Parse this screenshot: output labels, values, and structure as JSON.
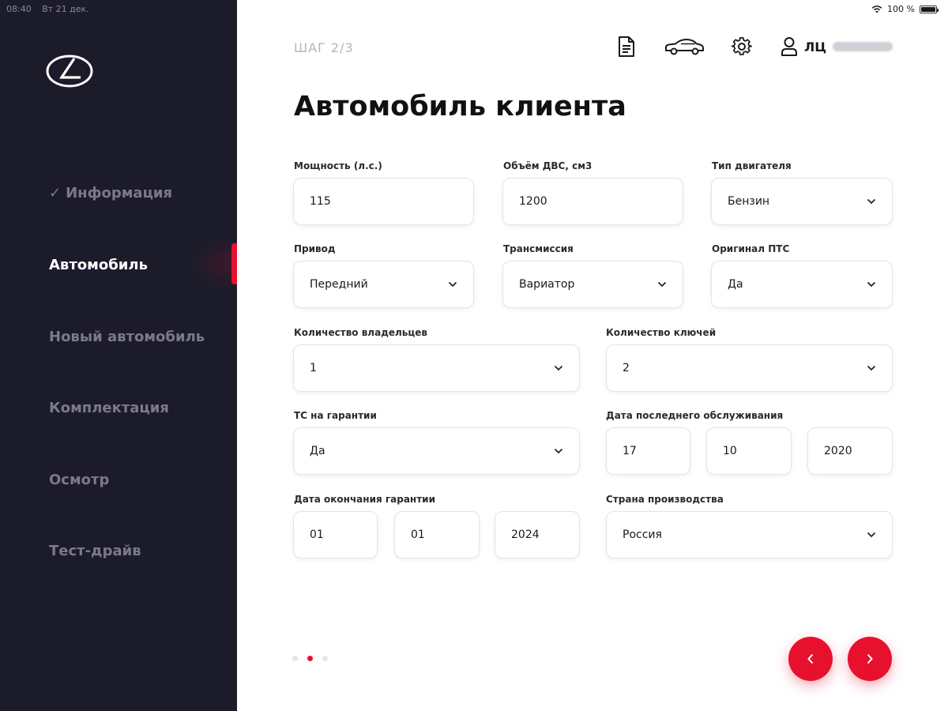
{
  "status_bar": {
    "time": "08:40",
    "date": "Вт 21 дек.",
    "battery": "100 %"
  },
  "sidebar": {
    "items": [
      {
        "label": "Информация",
        "state": "done"
      },
      {
        "label": "Автомобиль",
        "state": "active"
      },
      {
        "label": "Новый автомобиль",
        "state": "pending"
      },
      {
        "label": "Комплектация",
        "state": "pending"
      },
      {
        "label": "Осмотр",
        "state": "pending"
      },
      {
        "label": "Тест-драйв",
        "state": "pending"
      }
    ],
    "check_glyph": "✓"
  },
  "header": {
    "step": "ШАГ 2/3",
    "icons": [
      "document-icon",
      "car-icon",
      "gear-icon",
      "user-icon"
    ],
    "user_label": "ЛЦ"
  },
  "page_title": "Автомобиль клиента",
  "form": {
    "power": {
      "label": "Мощность (л.с.)",
      "value": "115"
    },
    "engine_volume": {
      "label": "Объём ДВС, см3",
      "value": "1200"
    },
    "engine_type": {
      "label": "Тип двигателя",
      "value": "Бензин"
    },
    "drive": {
      "label": "Привод",
      "value": "Передний"
    },
    "transmission": {
      "label": "Трансмиссия",
      "value": "Вариатор"
    },
    "original_pts": {
      "label": "Оригинал ПТС",
      "value": "Да"
    },
    "owners": {
      "label": "Количество владельцев",
      "value": "1"
    },
    "keys": {
      "label": "Количество ключей",
      "value": "2"
    },
    "warranty": {
      "label": "ТС на гарантии",
      "value": "Да"
    },
    "last_service": {
      "label": "Дата последнего обслуживания",
      "day": "17",
      "month": "10",
      "year": "2020"
    },
    "warranty_end": {
      "label": "Дата окончания гарантии",
      "day": "01",
      "month": "01",
      "year": "2024"
    },
    "country": {
      "label": "Страна производства",
      "value": "Россия"
    }
  },
  "pager": {
    "current": 2,
    "total": 3
  },
  "colors": {
    "accent": "#e8112d",
    "sidebar_bg": "#1c1b2a"
  }
}
